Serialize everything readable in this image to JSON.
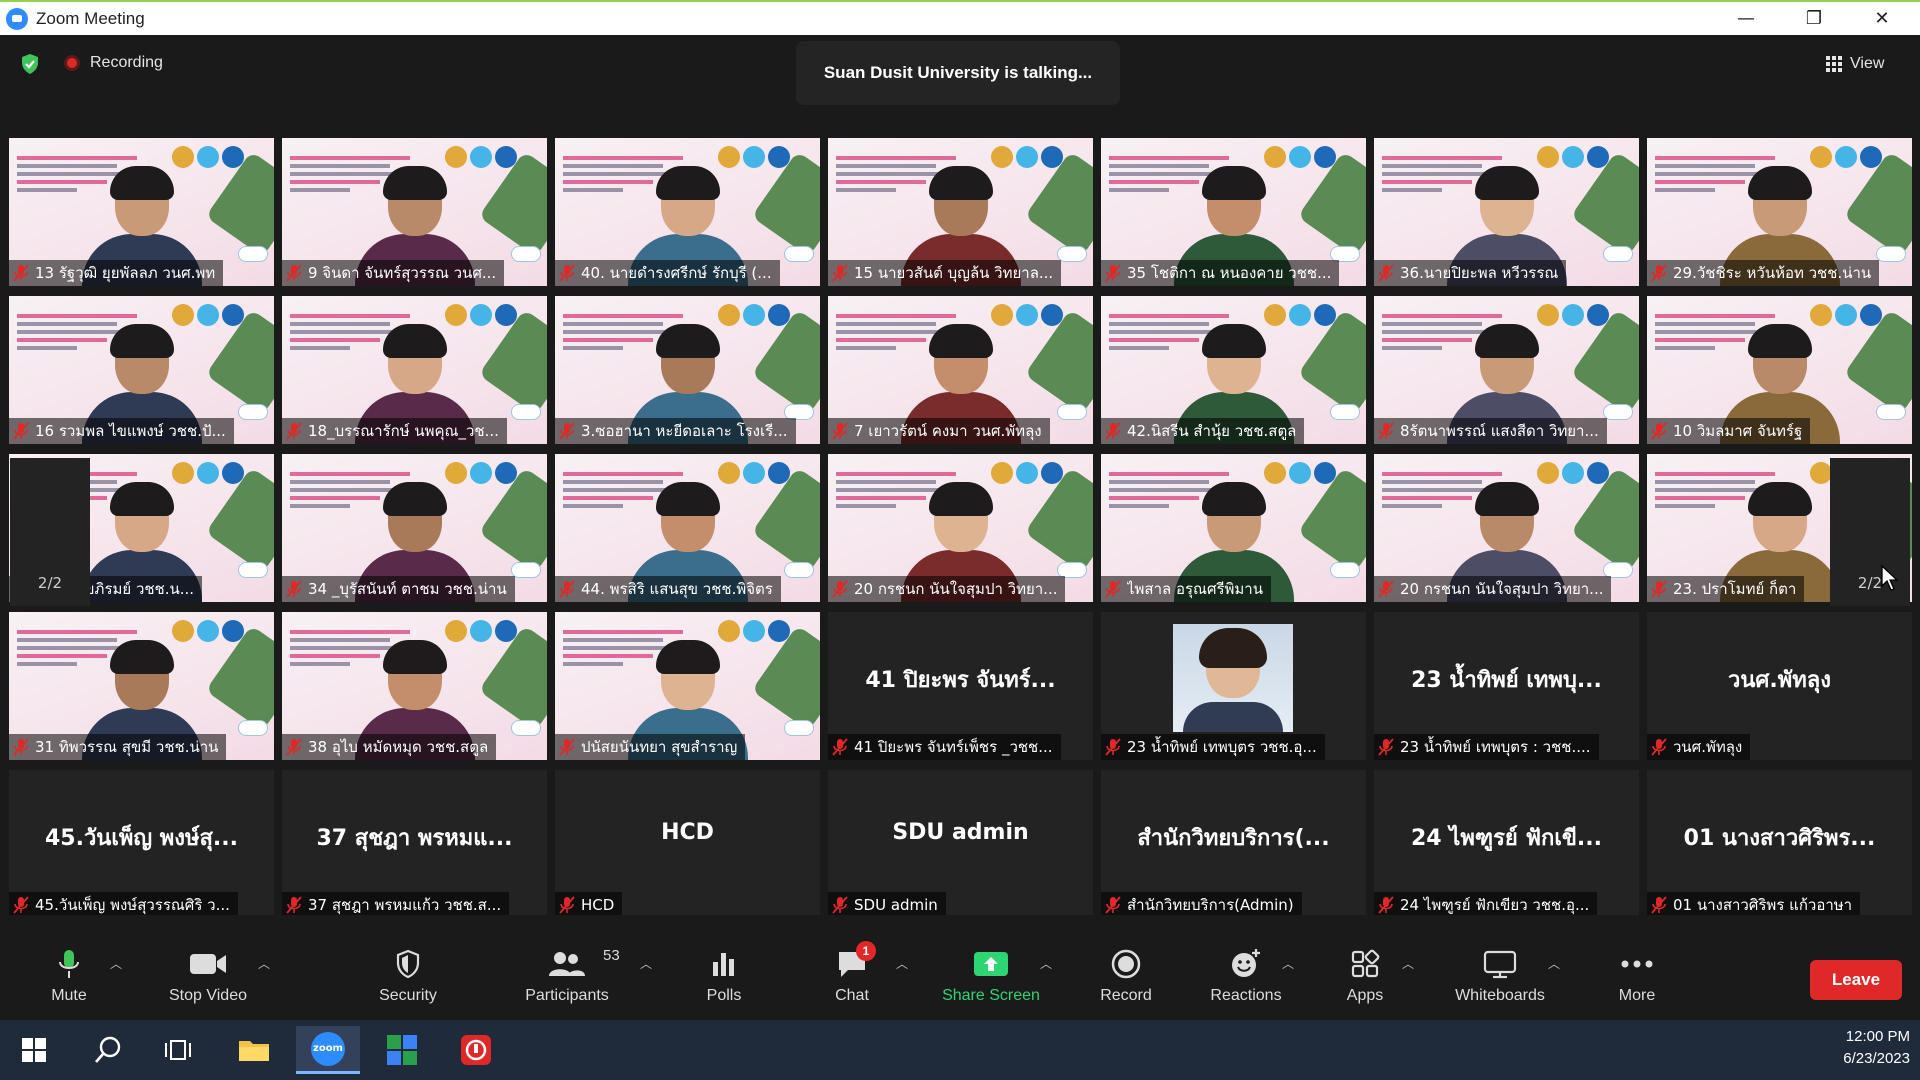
{
  "window": {
    "title": "Zoom Meeting",
    "minimize": "—",
    "restore": "❐",
    "close": "✕"
  },
  "header": {
    "recording_label": "Recording",
    "talking_text": "Suan Dusit University is talking...",
    "view_label": "View"
  },
  "pager": {
    "page_label": "2/2"
  },
  "tiles": [
    "13 รัฐวุฒิ ยุยพัลลภ วนศ.พท",
    "9 จินดา จันทร์สุวรรณ วนศ...",
    "40. นายดำรงศรีกษ์ รักบุรี (...",
    "15 นายวสันต์ บุญล้น วิทยาล...",
    "35 โชติกา ณ หนองคาย วชช...",
    "36.นายปิยะพล หวีวรรณ",
    "29.วัชชิระ หวันห้อท วชช.น่าน",
    "16 รวมพล ไขแพงษ์ วชช.ปั...",
    "18_บรรณารักษ์ นพคุณ_วช...",
    "3.ซอฮานา หะยีดอเลาะ โรงเรี...",
    "7 เยาวรัตน์ คงมา วนศ.พัทลุง",
    "42.นิสรีน สำนุ้ย วชช.สตูล",
    "8รัตนาพรรณ์ แสงสีดา วิทยา...",
    "10 วิมลมาศ จันทร์ฐ",
    "ยาวดี สุขภิรมย์ วชช.น...",
    "34 _บุรัสนันท์ ตาชม วชช.น่าน",
    "44. พรสิริ แสนสุข วชช.พิจิตร",
    "20 กรชนก นันใจสุมปา วิทยา...",
    "ไพสาล อรุณศรีพิมาน",
    "20 กรชนก นันใจสุมปา วิทยา...",
    "23. ปราโมทย์ ก็ตา",
    "31 ทิพวรรณ สุขมี วชช.น่าน",
    "38 อุไบ หมัดหมุด วชช.สตูล",
    "ปนัสยนันทยา สุขสำราญ",
    "41 ปิยะพร จันทร์เพ็ชร _วชช...",
    "23 น้ำทิพย์ เทพบุตร วชช.อุ...",
    "23 น้ำทิพย์ เทพบุตร : วชช....",
    "วนศ.พัทลุง",
    "45.วันเพ็ญ พงษ์สุวรรณศิริ ว...",
    "37 สุชฎา พรหมแก้ว วชช.ส...",
    "HCD",
    "SDU admin",
    "สำนักวิทยบริการ(Admin)",
    "24 ไพฑูรย์ ฟักเขียว วชช.อุ...",
    "01 นางสาวศิริพร แก้วอาษา"
  ],
  "big_names": {
    "t24": "41 ปิยะพร จันทร์...",
    "t26": "23 น้ำทิพย์ เทพบุ...",
    "t27": "วนศ.พัทลุง",
    "t28": "45.วันเพ็ญ พงษ์สุ...",
    "t29": "37 สุชฎา พรหมแ...",
    "t30": "HCD",
    "t31": "SDU admin",
    "t32": "สำนักวิทยบริการ(...",
    "t33": "24 ไพฑูรย์ ฟักเขี...",
    "t34": "01 นางสาวศิริพร..."
  },
  "toolbar": {
    "mute": "Mute",
    "stop_video": "Stop Video",
    "security": "Security",
    "participants": "Participants",
    "participants_count": "53",
    "polls": "Polls",
    "chat": "Chat",
    "chat_badge": "1",
    "share_screen": "Share Screen",
    "record": "Record",
    "reactions": "Reactions",
    "apps": "Apps",
    "whiteboards": "Whiteboards",
    "more": "More",
    "leave": "Leave"
  },
  "taskbar": {
    "time": "12:00 PM",
    "date": "6/23/2023",
    "zoom_label": "zoom"
  },
  "colors": {
    "accent": "#2d8cff",
    "leave": "#e02828",
    "share": "#2ed573",
    "muted": "#e02828"
  }
}
